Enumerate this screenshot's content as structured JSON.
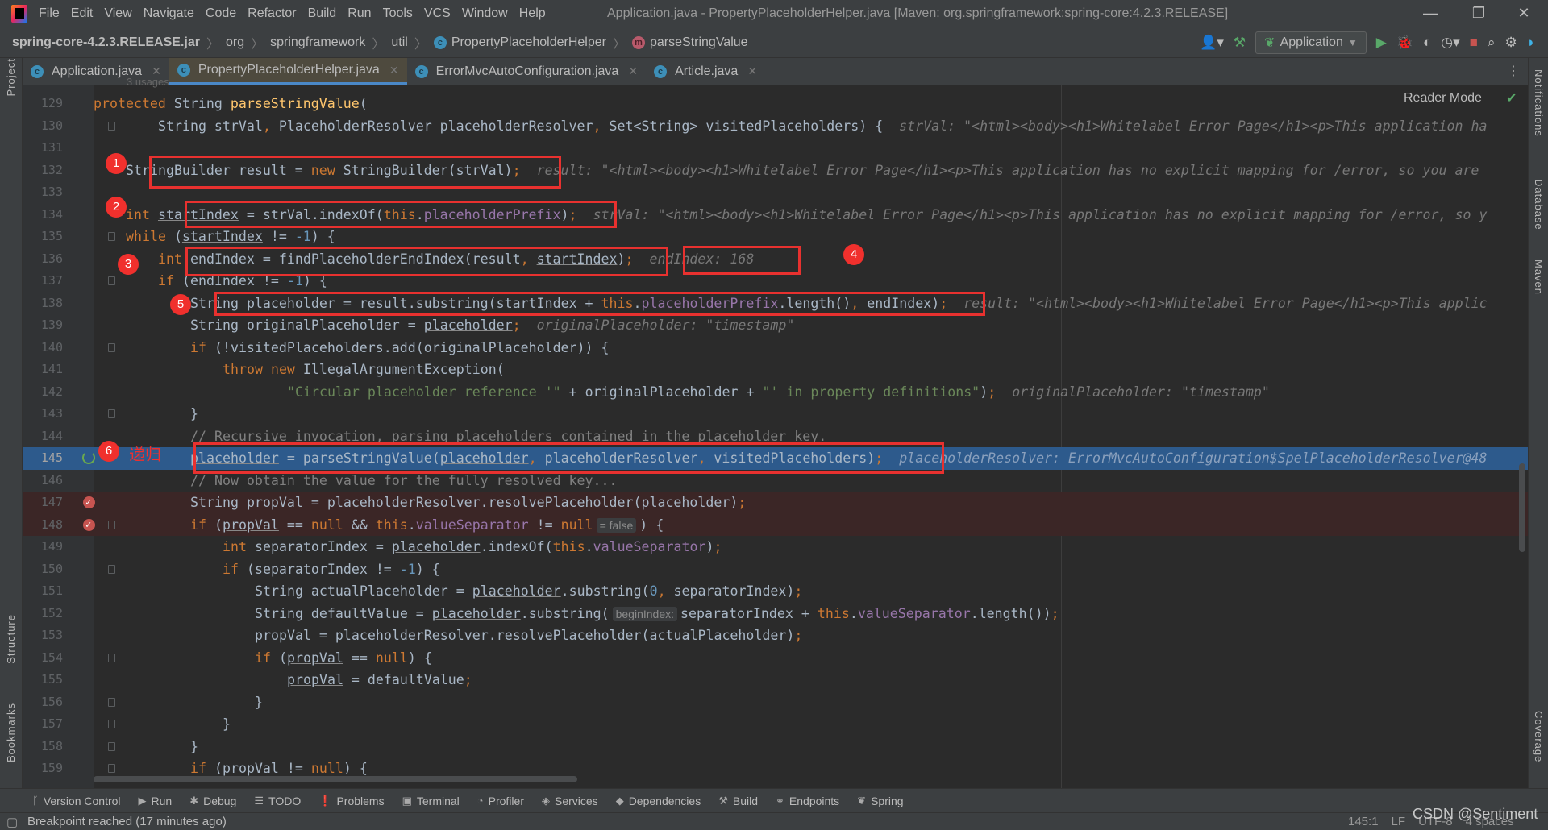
{
  "menubar": {
    "items": [
      "File",
      "Edit",
      "View",
      "Navigate",
      "Code",
      "Refactor",
      "Build",
      "Run",
      "Tools",
      "VCS",
      "Window",
      "Help"
    ],
    "title": "Application.java - PropertyPlaceholderHelper.java [Maven: org.springframework:spring-core:4.2.3.RELEASE]",
    "window_controls": [
      "—",
      "❐",
      "✕"
    ]
  },
  "breadcrumb": {
    "items": [
      {
        "label": "spring-core-4.2.3.RELEASE.jar",
        "icon": ""
      },
      {
        "label": "org",
        "icon": ""
      },
      {
        "label": "springframework",
        "icon": ""
      },
      {
        "label": "util",
        "icon": ""
      },
      {
        "label": "PropertyPlaceholderHelper",
        "icon": "c"
      },
      {
        "label": "parseStringValue",
        "icon": "m"
      }
    ]
  },
  "toolbar": {
    "run_config": "Application"
  },
  "tabs": [
    {
      "label": "Application.java",
      "active": false
    },
    {
      "label": "PropertyPlaceholderHelper.java",
      "active": true
    },
    {
      "label": "ErrorMvcAutoConfiguration.java",
      "active": false
    },
    {
      "label": "Article.java",
      "active": false
    }
  ],
  "side_panels": {
    "left": [
      "Project",
      "Structure",
      "Bookmarks"
    ],
    "right": [
      "Notifications",
      "Database",
      "Maven",
      "Coverage"
    ]
  },
  "editor": {
    "reader_mode": "Reader Mode",
    "usages": "3 usages",
    "lines": [
      {
        "n": 129,
        "indent": 4,
        "tokens": [
          [
            "protected",
            "k"
          ],
          [
            " String ",
            ""
          ],
          [
            "parseStringValue",
            "m"
          ],
          [
            "(",
            ""
          ]
        ]
      },
      {
        "n": 130,
        "indent": 12,
        "fold": true,
        "tokens": [
          [
            "String strVal",
            ""
          ],
          [
            ",",
            "k"
          ],
          [
            " PlaceholderResolver placeholderResolver",
            ""
          ],
          [
            ",",
            "k"
          ],
          [
            " Set<String> visitedPlaceholders) {",
            ""
          ]
        ],
        "hint": "strVal: \"<html><body><h1>Whitelabel Error Page</h1><p>This application ha"
      },
      {
        "n": 131,
        "indent": 0,
        "tokens": []
      },
      {
        "n": 132,
        "indent": 8,
        "tokens": [
          [
            "StringBuilder result = ",
            ""
          ],
          [
            "new",
            "k"
          ],
          [
            " StringBuilder(strVal)",
            ""
          ],
          [
            ";",
            "k"
          ]
        ],
        "hint": "result: \"<html><body><h1>Whitelabel Error Page</h1><p>This application has no explicit mapping for /error, so you are "
      },
      {
        "n": 133,
        "indent": 0,
        "tokens": []
      },
      {
        "n": 134,
        "indent": 8,
        "tokens": [
          [
            "int",
            "k"
          ],
          [
            " ",
            ""
          ],
          [
            "startIndex",
            "u"
          ],
          [
            " = strVal.indexOf(",
            ""
          ],
          [
            "this",
            "k"
          ],
          [
            ".",
            ""
          ],
          [
            "placeholderPrefix",
            "f"
          ],
          [
            ")",
            ""
          ],
          [
            ";",
            "k"
          ]
        ],
        "hint": "strVal: \"<html><body><h1>Whitelabel Error Page</h1><p>This application has no explicit mapping for /error, so y"
      },
      {
        "n": 135,
        "indent": 8,
        "fold": true,
        "tokens": [
          [
            "while",
            "k"
          ],
          [
            " (",
            ""
          ],
          [
            "startIndex",
            "u"
          ],
          [
            " != ",
            ""
          ],
          [
            "-1",
            "n"
          ],
          [
            ") {",
            ""
          ]
        ]
      },
      {
        "n": 136,
        "indent": 12,
        "tokens": [
          [
            "int",
            "k"
          ],
          [
            " endIndex = findPlaceholderEndIndex(result",
            ""
          ],
          [
            ",",
            "k"
          ],
          [
            " ",
            ""
          ],
          [
            "startIndex",
            "u"
          ],
          [
            ")",
            ""
          ],
          [
            ";",
            "k"
          ]
        ],
        "hint": "endIndex: 168"
      },
      {
        "n": 137,
        "indent": 12,
        "fold": true,
        "tokens": [
          [
            "if",
            "k"
          ],
          [
            " (endIndex != ",
            ""
          ],
          [
            "-1",
            "n"
          ],
          [
            ") {",
            ""
          ]
        ]
      },
      {
        "n": 138,
        "indent": 16,
        "tokens": [
          [
            "String ",
            ""
          ],
          [
            "placeholder",
            "u"
          ],
          [
            " = result.substring(",
            ""
          ],
          [
            "startIndex",
            "u"
          ],
          [
            " + ",
            ""
          ],
          [
            "this",
            "k"
          ],
          [
            ".",
            ""
          ],
          [
            "placeholderPrefix",
            "f"
          ],
          [
            ".length()",
            ""
          ],
          [
            ",",
            "k"
          ],
          [
            " endIndex)",
            ""
          ],
          [
            ";",
            "k"
          ]
        ],
        "hint": "result: \"<html><body><h1>Whitelabel Error Page</h1><p>This applic"
      },
      {
        "n": 139,
        "indent": 16,
        "tokens": [
          [
            "String originalPlaceholder = ",
            ""
          ],
          [
            "placeholder",
            "u"
          ],
          [
            ";",
            "k"
          ]
        ],
        "hint": "originalPlaceholder: \"timestamp\""
      },
      {
        "n": 140,
        "indent": 16,
        "fold": true,
        "tokens": [
          [
            "if",
            "k"
          ],
          [
            " (!visitedPlaceholders.add(originalPlaceholder)) {",
            ""
          ]
        ]
      },
      {
        "n": 141,
        "indent": 20,
        "tokens": [
          [
            "throw",
            "k"
          ],
          [
            " ",
            ""
          ],
          [
            "new",
            "k"
          ],
          [
            " IllegalArgumentException(",
            ""
          ]
        ]
      },
      {
        "n": 142,
        "indent": 28,
        "tokens": [
          [
            "\"Circular placeholder reference '\"",
            "s"
          ],
          [
            " + originalPlaceholder + ",
            ""
          ],
          [
            "\"' in property definitions\"",
            "s"
          ],
          [
            ")",
            ""
          ],
          [
            ";",
            "k"
          ]
        ],
        "hint": "originalPlaceholder: \"timestamp\""
      },
      {
        "n": 143,
        "indent": 16,
        "fold": true,
        "tokens": [
          [
            "}",
            ""
          ]
        ]
      },
      {
        "n": 144,
        "indent": 16,
        "tokens": [
          [
            "// Recursive invocation, parsing placeholders contained in the placeholder key.",
            "c"
          ]
        ]
      },
      {
        "n": 145,
        "indent": 16,
        "exec": true,
        "tokens": [
          [
            "placeholder",
            "u"
          ],
          [
            " = parseStringValue(",
            ""
          ],
          [
            "placeholder",
            "u"
          ],
          [
            ",",
            "k"
          ],
          [
            " placeholderResolver",
            ""
          ],
          [
            ",",
            "k"
          ],
          [
            " visitedPlaceholders)",
            ""
          ],
          [
            ";",
            "k"
          ]
        ],
        "hint": "placeholderResolver: ErrorMvcAutoConfiguration$SpelPlaceholderResolver@48"
      },
      {
        "n": 146,
        "indent": 16,
        "tokens": [
          [
            "// Now obtain the value for the fully resolved key...",
            "c"
          ]
        ]
      },
      {
        "n": 147,
        "indent": 16,
        "bp": true,
        "tokens": [
          [
            "String ",
            ""
          ],
          [
            "propVal",
            "u"
          ],
          [
            " = placeholderResolver.resolvePlaceholder(",
            ""
          ],
          [
            "placeholder",
            "u"
          ],
          [
            ")",
            ""
          ],
          [
            ";",
            "k"
          ]
        ]
      },
      {
        "n": 148,
        "indent": 16,
        "bp": true,
        "fold": true,
        "tokens": [
          [
            "if",
            "k"
          ],
          [
            " (",
            ""
          ],
          [
            "propVal",
            "u"
          ],
          [
            " == ",
            ""
          ],
          [
            "null",
            "k"
          ],
          [
            " && ",
            ""
          ],
          [
            "this",
            "k"
          ],
          [
            ".",
            ""
          ],
          [
            "valueSeparator",
            "f"
          ],
          [
            " != ",
            ""
          ],
          [
            "null",
            "k"
          ],
          [
            "= false",
            "chip"
          ],
          [
            ") {",
            ""
          ]
        ]
      },
      {
        "n": 149,
        "indent": 20,
        "tokens": [
          [
            "int",
            "k"
          ],
          [
            " separatorIndex = ",
            ""
          ],
          [
            "placeholder",
            "u"
          ],
          [
            ".indexOf(",
            ""
          ],
          [
            "this",
            "k"
          ],
          [
            ".",
            ""
          ],
          [
            "valueSeparator",
            "f"
          ],
          [
            ")",
            ""
          ],
          [
            ";",
            "k"
          ]
        ]
      },
      {
        "n": 150,
        "indent": 20,
        "fold": true,
        "tokens": [
          [
            "if",
            "k"
          ],
          [
            " (separatorIndex != ",
            ""
          ],
          [
            "-1",
            "n"
          ],
          [
            ") {",
            ""
          ]
        ]
      },
      {
        "n": 151,
        "indent": 24,
        "tokens": [
          [
            "String actualPlaceholder = ",
            ""
          ],
          [
            "placeholder",
            "u"
          ],
          [
            ".substring(",
            ""
          ],
          [
            "0",
            "n"
          ],
          [
            ",",
            "k"
          ],
          [
            " separatorIndex)",
            ""
          ],
          [
            ";",
            "k"
          ]
        ]
      },
      {
        "n": 152,
        "indent": 24,
        "tokens": [
          [
            "String defaultValue = ",
            ""
          ],
          [
            "placeholder",
            "u"
          ],
          [
            ".substring(",
            ""
          ],
          [
            "beginIndex:",
            "chip"
          ],
          [
            "separatorIndex + ",
            ""
          ],
          [
            "this",
            "k"
          ],
          [
            ".",
            ""
          ],
          [
            "valueSeparator",
            "f"
          ],
          [
            ".length())",
            ""
          ],
          [
            ";",
            "k"
          ]
        ]
      },
      {
        "n": 153,
        "indent": 24,
        "tokens": [
          [
            "propVal",
            "u"
          ],
          [
            " = placeholderResolver.resolvePlaceholder(actualPlaceholder)",
            ""
          ],
          [
            ";",
            "k"
          ]
        ]
      },
      {
        "n": 154,
        "indent": 24,
        "fold": true,
        "tokens": [
          [
            "if",
            "k"
          ],
          [
            " (",
            ""
          ],
          [
            "propVal",
            "u"
          ],
          [
            " == ",
            ""
          ],
          [
            "null",
            "k"
          ],
          [
            ") {",
            ""
          ]
        ]
      },
      {
        "n": 155,
        "indent": 28,
        "tokens": [
          [
            "propVal",
            "u"
          ],
          [
            " = defaultValue",
            ""
          ],
          [
            ";",
            "k"
          ]
        ]
      },
      {
        "n": 156,
        "indent": 24,
        "fold": true,
        "tokens": [
          [
            "}",
            ""
          ]
        ]
      },
      {
        "n": 157,
        "indent": 20,
        "fold": true,
        "tokens": [
          [
            "}",
            ""
          ]
        ]
      },
      {
        "n": 158,
        "indent": 16,
        "fold": true,
        "tokens": [
          [
            "}",
            ""
          ]
        ]
      },
      {
        "n": 159,
        "indent": 16,
        "fold": true,
        "tokens": [
          [
            "if",
            "k"
          ],
          [
            " (",
            ""
          ],
          [
            "propVal",
            "u"
          ],
          [
            " != ",
            ""
          ],
          [
            "null",
            "k"
          ],
          [
            ") {",
            ""
          ]
        ]
      }
    ]
  },
  "annotations": {
    "badges": [
      "1",
      "2",
      "3",
      "4",
      "5",
      "6"
    ],
    "recursion_label": "递归",
    "box_color": "#e8312f"
  },
  "bottom_tools": [
    "Version Control",
    "Run",
    "Debug",
    "TODO",
    "Problems",
    "Terminal",
    "Profiler",
    "Services",
    "Dependencies",
    "Build",
    "Endpoints",
    "Spring"
  ],
  "status": {
    "message": "Breakpoint reached (17 minutes ago)",
    "position": "145:1",
    "line_ending": "LF",
    "encoding": "UTF-8",
    "indent": "4 spaces"
  },
  "watermark": "CSDN @Sentiment"
}
